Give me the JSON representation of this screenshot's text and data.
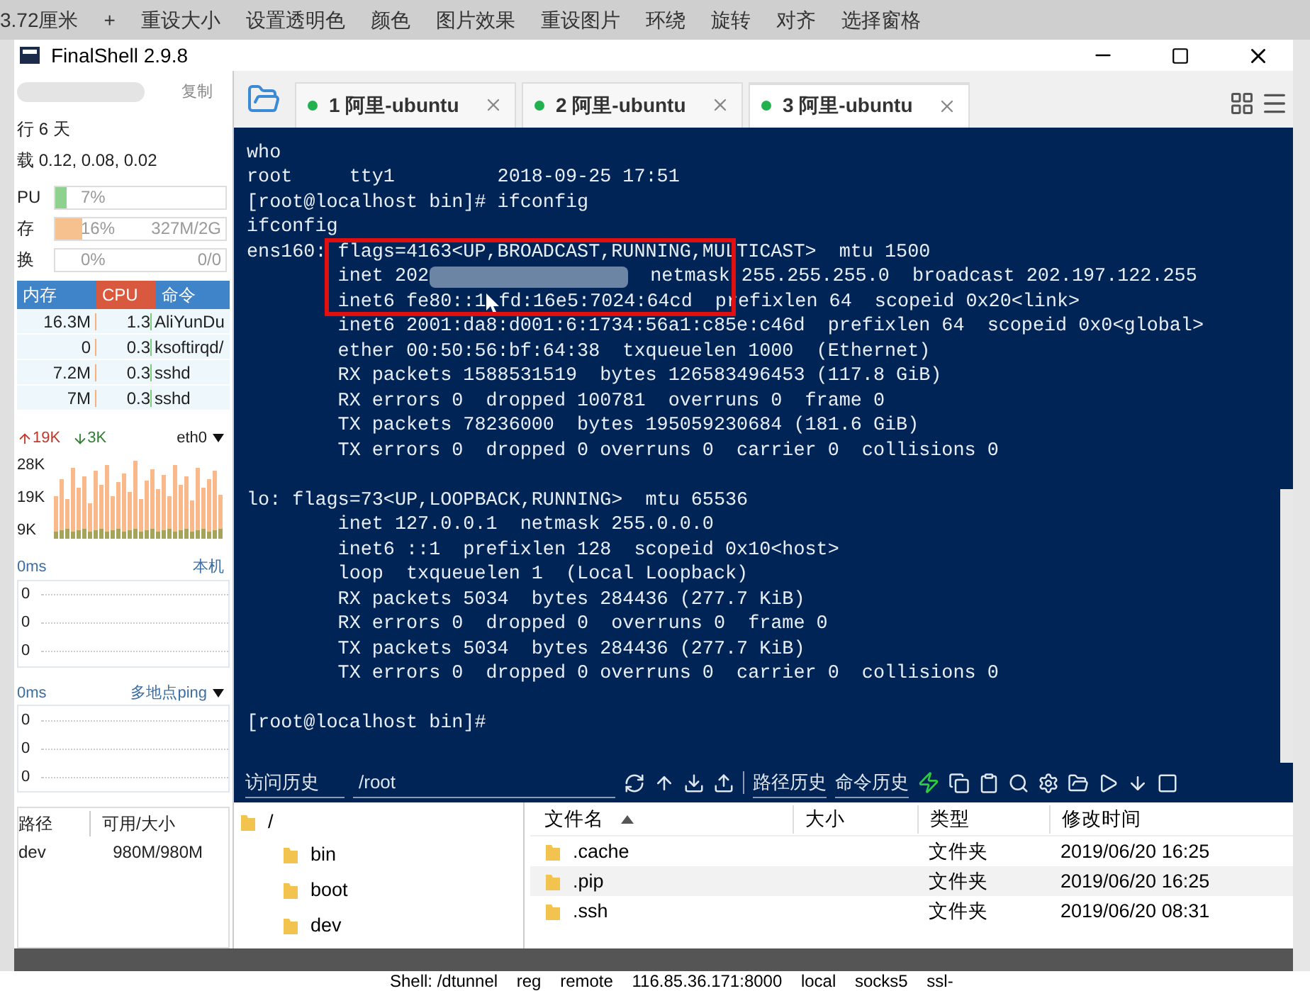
{
  "ribbon": {
    "items": [
      "3.72厘米",
      "+",
      "重设大小",
      "设置透明色",
      "颜色",
      "图片效果",
      "重设图片",
      "环绕",
      "旋转",
      "对齐",
      "选择窗格"
    ]
  },
  "window": {
    "title": "FinalShell 2.9.8"
  },
  "sidebar": {
    "copy_link": "复制",
    "uptime": "行 6 天",
    "load": "载 0.12, 0.08, 0.02",
    "meters": [
      {
        "label": "PU",
        "reading": "7%",
        "level": 0.07,
        "color": "#8fd18f"
      },
      {
        "label": "存",
        "reading": "16%",
        "detail": "327M/2G",
        "level": 0.16,
        "color": "#f7c08f"
      },
      {
        "label": "换",
        "reading": "0%",
        "detail": "0/0"
      }
    ],
    "process_table": {
      "columns": [
        "内存",
        "CPU",
        "命令"
      ],
      "rows": [
        {
          "mem": "16.3M",
          "cpu": "1.3",
          "command": "AliYunDu"
        },
        {
          "mem": "0",
          "cpu": "0.3",
          "command": "ksoftirqd/"
        },
        {
          "mem": "7.2M",
          "cpu": "0.3",
          "command": "sshd"
        },
        {
          "mem": "7M",
          "cpu": "0.3",
          "command": "sshd"
        }
      ]
    },
    "network": {
      "up": "19K",
      "down": "3K",
      "interface": "eth0",
      "axis": [
        "28K",
        "19K",
        "9K"
      ]
    },
    "ping_panels": [
      {
        "scale": "0ms",
        "target": "本机",
        "dropdown": false,
        "axis": [
          "0",
          "0",
          "0"
        ]
      },
      {
        "scale": "0ms",
        "target": "多地点ping",
        "dropdown": true,
        "axis": [
          "0",
          "0",
          "0"
        ]
      }
    ],
    "disk_table": {
      "columns": [
        "路径",
        "可用/大小"
      ],
      "rows": [
        {
          "path": "dev",
          "size": "980M/980M"
        }
      ]
    }
  },
  "tabs": [
    {
      "label": "1 阿里-ubuntu",
      "selected": false
    },
    {
      "label": "2 阿里-ubuntu",
      "selected": false
    },
    {
      "label": "3 阿里-ubuntu",
      "selected": true
    }
  ],
  "terminal": {
    "lines": [
      {
        "kind": "text",
        "text": "who"
      },
      {
        "kind": "text",
        "text": "root     tty1         2018-09-25 17:51"
      },
      {
        "kind": "text",
        "text": "[root@localhost bin]# ifconfig"
      },
      {
        "kind": "text",
        "text": "ifconfig"
      },
      {
        "kind": "text",
        "text": "ens160: flags=4163<UP,BROADCAST,RUNNING,MULTICAST>  mtu 1500"
      },
      {
        "kind": "blurred",
        "before": "        inet 202",
        "after": "  netmask 255.255.255.0  broadcast 202.197.122.255"
      },
      {
        "kind": "cursor",
        "before": "        inet6 fe80::1",
        "after": "fd:16e5:7024:64cd  prefixlen 64  scopeid 0x20<link>"
      },
      {
        "kind": "text",
        "text": "        inet6 2001:da8:d001:6:1734:56a1:c85e:c46d  prefixlen 64  scopeid 0x0<global>"
      },
      {
        "kind": "text",
        "text": "        ether 00:50:56:bf:64:38  txqueuelen 1000  (Ethernet)"
      },
      {
        "kind": "text",
        "text": "        RX packets 1588531519  bytes 126583496453 (117.8 GiB)"
      },
      {
        "kind": "text",
        "text": "        RX errors 0  dropped 100781  overruns 0  frame 0"
      },
      {
        "kind": "text",
        "text": "        TX packets 78236000  bytes 195059230684 (181.6 GiB)"
      },
      {
        "kind": "text",
        "text": "        TX errors 0  dropped 0 overruns 0  carrier 0  collisions 0"
      },
      {
        "kind": "blank"
      },
      {
        "kind": "text",
        "text": "lo: flags=73<UP,LOOPBACK,RUNNING>  mtu 65536"
      },
      {
        "kind": "text",
        "text": "        inet 127.0.0.1  netmask 255.0.0.0"
      },
      {
        "kind": "text",
        "text": "        inet6 ::1  prefixlen 128  scopeid 0x10<host>"
      },
      {
        "kind": "text",
        "text": "        loop  txqueuelen 1  (Local Loopback)"
      },
      {
        "kind": "text",
        "text": "        RX packets 5034  bytes 284436 (277.7 KiB)"
      },
      {
        "kind": "text",
        "text": "        RX errors 0  dropped 0  overruns 0  frame 0"
      },
      {
        "kind": "text",
        "text": "        TX packets 5034  bytes 284436 (277.7 KiB)"
      },
      {
        "kind": "text",
        "text": "        TX errors 0  dropped 0 overruns 0  carrier 0  collisions 0"
      },
      {
        "kind": "blank"
      },
      {
        "kind": "text",
        "text": "[root@localhost bin]#"
      }
    ]
  },
  "toolbar": {
    "history": "访问历史",
    "path": "/root",
    "path_history": "路径历史",
    "command_history": "命令历史"
  },
  "file_tree": {
    "label": "/",
    "children": [
      {
        "label": "bin"
      },
      {
        "label": "boot"
      },
      {
        "label": "dev"
      }
    ]
  },
  "file_table": {
    "columns": [
      "文件名",
      "大小",
      "类型",
      "修改时间"
    ],
    "rows": [
      {
        "name": ".cache",
        "type": "文件夹",
        "modified": "2019/06/20 16:25",
        "selected": false
      },
      {
        "name": ".pip",
        "type": "文件夹",
        "modified": "2019/06/20 16:25",
        "selected": true
      },
      {
        "name": ".ssh",
        "type": "文件夹",
        "modified": "2019/06/20 08:31",
        "selected": false
      }
    ]
  },
  "document": {
    "line": "Shell: /dtunnel    reg    remote    116.85.36.171:8000    local    socks5    ssl-"
  }
}
